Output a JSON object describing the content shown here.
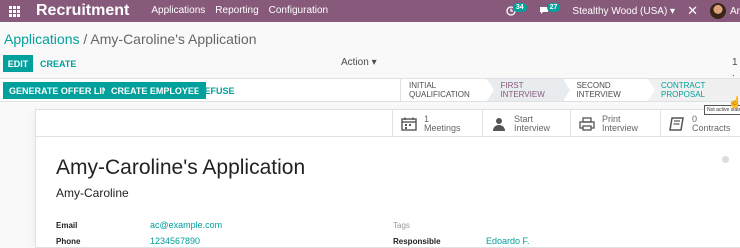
{
  "navbar": {
    "brand": "Recruitment",
    "menu": [
      "Applications",
      "Reporting",
      "Configuration"
    ],
    "activity_count": "34",
    "message_count": "27",
    "company": "Stealthy Wood (USA)",
    "user_name": "Ar"
  },
  "breadcrumb": {
    "parent": "Applications",
    "separator": "/",
    "current": "Amy-Caroline's Application"
  },
  "controls": {
    "edit_label": "EDIT",
    "create_label": "CREATE",
    "action_label": "Action",
    "pager": "1 ."
  },
  "statusbar": {
    "buttons": [
      "GENERATE OFFER LINK",
      "CREATE EMPLOYEE"
    ],
    "refuse_label": "REFUSE",
    "stages": [
      "INITIAL QUALIFICATION",
      "FIRST INTERVIEW",
      "SECOND INTERVIEW",
      "CONTRACT PROPOSAL"
    ],
    "active_stage": "FIRST INTERVIEW",
    "tooltip": "Not active state"
  },
  "smart_buttons": [
    {
      "icon": "calendar-icon",
      "line1": "1",
      "line2": "Meetings"
    },
    {
      "icon": "user-icon",
      "line1": "Start",
      "line2": "Interview"
    },
    {
      "icon": "print-icon",
      "line1": "Print",
      "line2": "Interview"
    },
    {
      "icon": "book-icon",
      "line1": "0",
      "line2": "Contracts"
    }
  ],
  "form": {
    "title": "Amy-Caroline's Application",
    "applicant_name": "Amy-Caroline",
    "email_label": "Email",
    "email": "ac@example.com",
    "phone_label": "Phone",
    "phone": "1234567890",
    "tags_label": "Tags",
    "responsible_label": "Responsible",
    "responsible": "Edoardo F."
  },
  "colors": {
    "navbar": "#875a7b",
    "accent": "#00a09d"
  }
}
